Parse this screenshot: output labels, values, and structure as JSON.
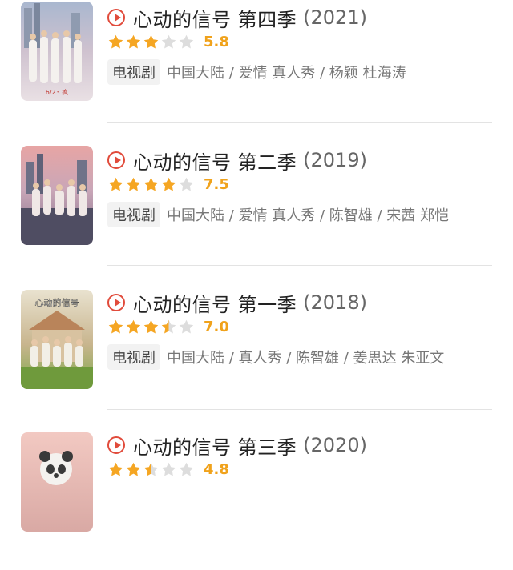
{
  "items": [
    {
      "title": "心动的信号 第四季",
      "year": "(2021)",
      "score": "5.8",
      "stars": 3,
      "tag": "电视剧",
      "meta": "中国大陆 / 爱情 真人秀 / 杨颖 杜海涛",
      "poster_caption": "6/23 疯"
    },
    {
      "title": "心动的信号 第二季",
      "year": "(2019)",
      "score": "7.5",
      "stars": 4,
      "tag": "电视剧",
      "meta": "中国大陆 / 爱情 真人秀 / 陈智雄 / 宋茜 郑恺"
    },
    {
      "title": "心动的信号 第一季",
      "year": "(2018)",
      "score": "7.0",
      "stars": 3.5,
      "tag": "电视剧",
      "meta": "中国大陆 / 真人秀 / 陈智雄 / 姜思达 朱亚文",
      "poster_caption": "心动的信号"
    },
    {
      "title": "心动的信号 第三季",
      "year": "(2020)",
      "score": "4.8",
      "stars": 2.5
    }
  ],
  "colors": {
    "accent": "#e14b3b",
    "star": "#f5a623",
    "star_empty": "#dddddd",
    "score": "#f0a21b"
  }
}
